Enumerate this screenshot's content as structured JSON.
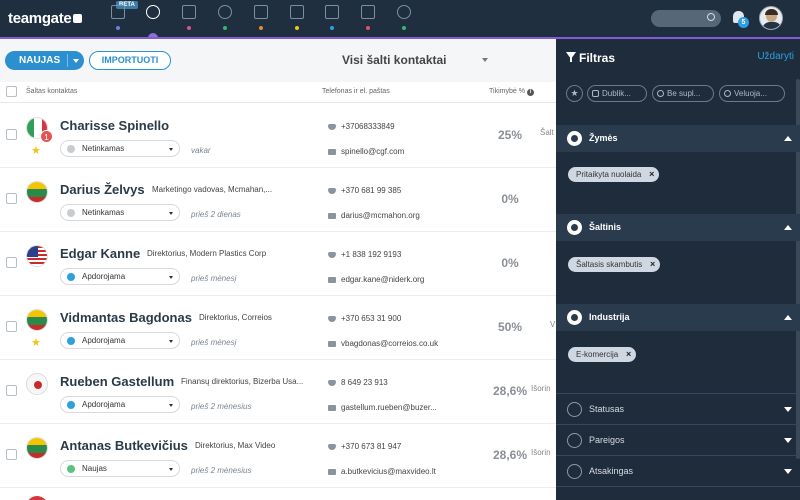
{
  "app": {
    "logo": "teamgate",
    "beta_label": "BETA"
  },
  "nav": {
    "icons": [
      "contacts-icon",
      "deals-icon",
      "companies-icon",
      "people-icon",
      "briefcase-icon",
      "calendar-icon",
      "inbox-icon",
      "documents-icon",
      "reports-icon"
    ],
    "dot_colors": [
      "#6b7fe0",
      "#2f9fe0",
      "#d94e9e",
      "#39b66a",
      "#e88a2f",
      "#f0c419",
      "#2f9fe0",
      "#e35454",
      "#39b66a"
    ]
  },
  "header": {
    "notification_count": "5"
  },
  "toolbar": {
    "new_label": "NAUJAS",
    "import_label": "IMPORTUOTI",
    "view_title": "Visi šalti kontaktai"
  },
  "table": {
    "col_contact": "Šaltas kontaktas",
    "col_phone_email": "Telefonas ir el. paštas",
    "col_probability": "Tikimybė %",
    "rows": [
      {
        "name": "Charisse Spinello",
        "title": "",
        "status": "Netinkamas",
        "status_color": "#c8ccd1",
        "when": "vakar",
        "phone": "+37068333849",
        "email": "spinello@cgf.com",
        "probability": "25%",
        "trailing": "Šalt",
        "flag": "italy",
        "badge": "1",
        "starred": true
      },
      {
        "name": "Darius Želvys",
        "title": "Marketingo vadovas, Mcmahan,...",
        "status": "Netinkamas",
        "status_color": "#c8ccd1",
        "when": "prieš 2 dienas",
        "phone": "+370 681 99 385",
        "email": "darius@mcmahon.org",
        "probability": "0%",
        "trailing": "",
        "flag": "lithuania",
        "badge": "",
        "starred": false
      },
      {
        "name": "Edgar Kanne",
        "title": "Direktorius, Modern Plastics Corp",
        "status": "Apdorojama",
        "status_color": "#2f9fe0",
        "when": "prieš mėnesį",
        "phone": "+1 838 192 9193",
        "email": "edgar.kane@niderk.org",
        "probability": "0%",
        "trailing": "",
        "flag": "usa",
        "badge": "",
        "starred": false
      },
      {
        "name": "Vidmantas Bagdonas",
        "title": "Direktorius, Correios",
        "status": "Apdorojama",
        "status_color": "#2f9fe0",
        "when": "prieš mėnesį",
        "phone": "+370 653 31 900",
        "email": "vbagdonas@correios.co.uk",
        "probability": "50%",
        "trailing": "V",
        "flag": "lithuania",
        "badge": "",
        "starred": true
      },
      {
        "name": "Rueben Gastellum",
        "title": "Finansų direktorius, Bizerba Usa...",
        "status": "Apdorojama",
        "status_color": "#2f9fe0",
        "when": "prieš 2 mėnesius",
        "phone": "8 649 23 913",
        "email": "gastellum.rueben@buzer...",
        "probability": "28,6%",
        "trailing": "Išorin",
        "flag": "japan",
        "badge": "",
        "starred": false
      },
      {
        "name": "Antanas Butkevičius",
        "title": "Direktorius, Max Video",
        "status": "Naujas",
        "status_color": "#5cc37e",
        "when": "prieš 2 mėnesius",
        "phone": "+370 673 81 947",
        "email": "a.butkevicius@maxvideo.lt",
        "probability": "28,6%",
        "trailing": "Išorin",
        "flag": "lithuania",
        "badge": "",
        "starred": false
      }
    ]
  },
  "filters": {
    "title": "Filtras",
    "close_label": "Uždaryti",
    "quick": [
      "Dublik...",
      "Be supl...",
      "Veluoja..."
    ],
    "sections": [
      {
        "label": "Žymės",
        "tags": [
          "Pritaikyta nuolaida"
        ]
      },
      {
        "label": "Šaltinis",
        "tags": [
          "Šaltasis skambutis"
        ]
      },
      {
        "label": "Industrija",
        "tags": [
          "E-komercija"
        ]
      }
    ],
    "collapsed": [
      "Statusas",
      "Pareigos",
      "Atsakingas"
    ]
  }
}
